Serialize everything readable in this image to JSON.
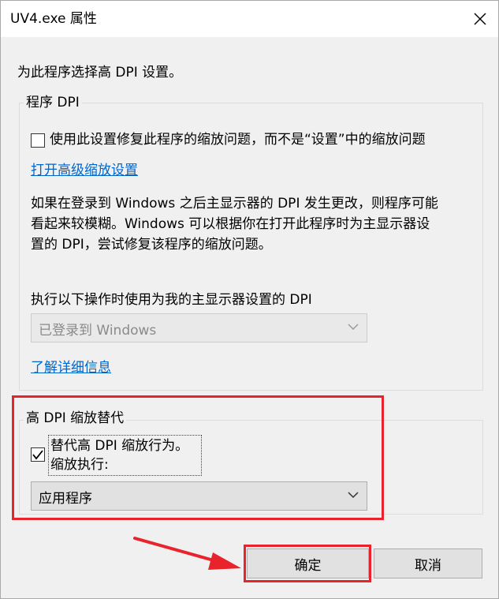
{
  "window": {
    "title": "UV4.exe 属性",
    "close_glyph": "✕"
  },
  "intro_text": "为此程序选择高 DPI 设置。",
  "program_dpi": {
    "legend": "程序 DPI",
    "checkbox_label": "使用此设置修复此程序的缩放问题，而不是“设置”中的缩放问题",
    "checkbox_checked": false,
    "advanced_link": "打开高级缩放设置",
    "description_lines": [
      "如果在登录到 Windows 之后主显示器的 DPI 发生更改，则程序可能",
      "看起来较模糊。Windows 可以根据你在打开此程序时为主显示器设",
      "置的 DPI，尝试修复该程序的缩放问题。"
    ],
    "select_label": "执行以下操作时使用为我的主显示器设置的 DPI",
    "select_value": "已登录到 Windows",
    "select_disabled": true,
    "learn_more_link": "了解详细信息"
  },
  "high_dpi": {
    "legend": "高 DPI 缩放替代",
    "checkbox_label_line1": "替代高 DPI 缩放行为。",
    "checkbox_label_line2": "缩放执行:",
    "checkbox_checked": true,
    "select_value": "应用程序"
  },
  "buttons": {
    "ok": "确定",
    "cancel": "取消"
  },
  "colors": {
    "annotation_red": "#e8232b",
    "link_blue": "#0066cc",
    "disabled_text": "#8a8a8a"
  }
}
